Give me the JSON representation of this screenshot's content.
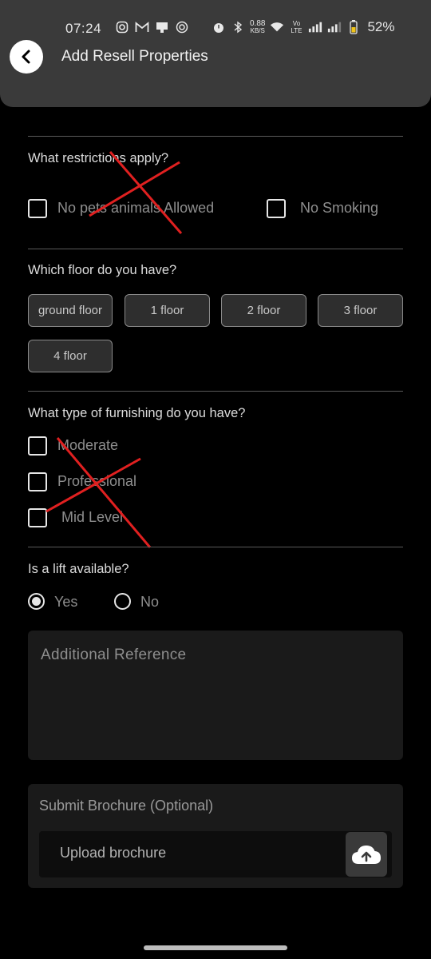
{
  "status_bar": {
    "time": "07:24",
    "speed_value": "0.88",
    "speed_unit": "KB/S",
    "network_label": "Vo LTE",
    "battery": "52%"
  },
  "header": {
    "title": "Add Resell Properties"
  },
  "restrictions": {
    "question": "What restrictions apply?",
    "options": [
      "No pets animals Allowed",
      "No Smoking"
    ]
  },
  "floor": {
    "question": "Which floor do you have?",
    "options": [
      "ground floor",
      "1 floor",
      "2 floor",
      "3 floor",
      "4 floor"
    ]
  },
  "furnishing": {
    "question": "What type of furnishing do you have?",
    "options": [
      "Moderate",
      "Professional",
      "Mid Level"
    ]
  },
  "lift": {
    "question": "Is a lift available?",
    "options": [
      "Yes",
      "No"
    ],
    "selected": "Yes"
  },
  "additional_reference": {
    "placeholder": "Additional Reference"
  },
  "brochure": {
    "title": "Submit Brochure (Optional)",
    "placeholder": "Upload brochure"
  },
  "colors": {
    "background": "#000000",
    "appbar": "#3a3a3a",
    "cross_mark": "#e02020"
  }
}
